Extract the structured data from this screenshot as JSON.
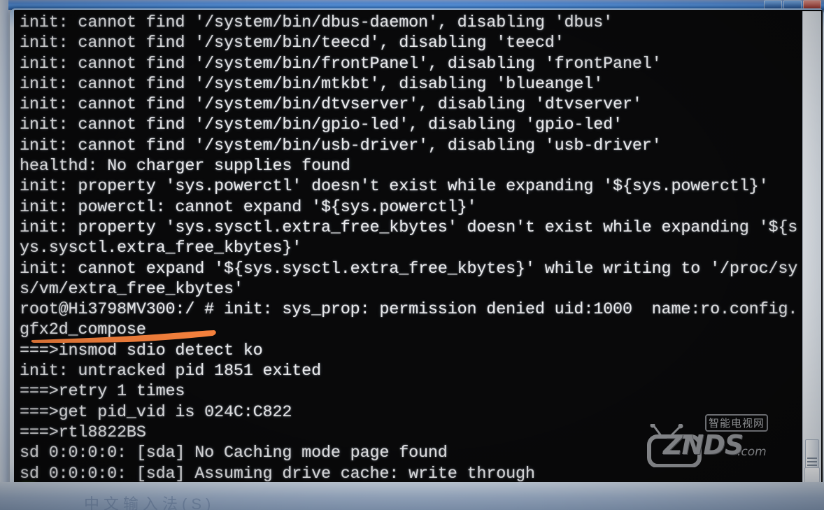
{
  "window": {
    "title": "",
    "buttons": [
      "minimize",
      "maximize",
      "close"
    ]
  },
  "console": {
    "lines": [
      "init: cannot find '/system/bin/dbus-daemon', disabling 'dbus'",
      "init: cannot find '/system/bin/teecd', disabling 'teecd'",
      "init: cannot find '/system/bin/frontPanel', disabling 'frontPanel'",
      "init: cannot find '/system/bin/mtkbt', disabling 'blueangel'",
      "init: cannot find '/system/bin/dtvserver', disabling 'dtvserver'",
      "init: cannot find '/system/bin/gpio-led', disabling 'gpio-led'",
      "init: cannot find '/system/bin/usb-driver', disabling 'usb-driver'",
      "healthd: No charger supplies found",
      "init: property 'sys.powerctl' doesn't exist while expanding '${sys.powerctl}'",
      "init: powerctl: cannot expand '${sys.powerctl}'",
      "init: property 'sys.sysctl.extra_free_kbytes' doesn't exist while expanding '${s",
      "ys.sysctl.extra_free_kbytes}'",
      "init: cannot expand '${sys.sysctl.extra_free_kbytes}' while writing to '/proc/sy",
      "s/vm/extra_free_kbytes'",
      "root@Hi3798MV300:/ # init: sys_prop: permission denied uid:1000  name:ro.config.",
      "gfx2d_compose",
      "===>insmod sdio detect ko",
      "init: untracked pid 1851 exited",
      "===>retry 1 times",
      "===>get pid_vid is 024C:C822",
      "===>rtl8822BS",
      "sd 0:0:0:0: [sda] No Caching mode page found",
      "sd 0:0:0:0: [sda] Assuming drive cache: write through"
    ],
    "prompt": "root@Hi3798MV300:/ #",
    "hostname": "Hi3798MV300",
    "cursor_visible": true,
    "cursor_color": "#7ce02c",
    "text_color": "#e9eaec",
    "background_color": "#09090a"
  },
  "annotation": {
    "type": "highlight-stroke",
    "color": "#f4803c",
    "covers_text": "gfx2d_compose"
  },
  "watermark": {
    "brand": "ZNDS",
    "suffix": ".com",
    "chinese_label": "智能电视网",
    "icon": "tv-icon"
  },
  "scrollbar": {
    "orientation": "vertical",
    "position_percent": 92
  },
  "desktop": {
    "taskbar_text": "中文输入法(S)"
  }
}
